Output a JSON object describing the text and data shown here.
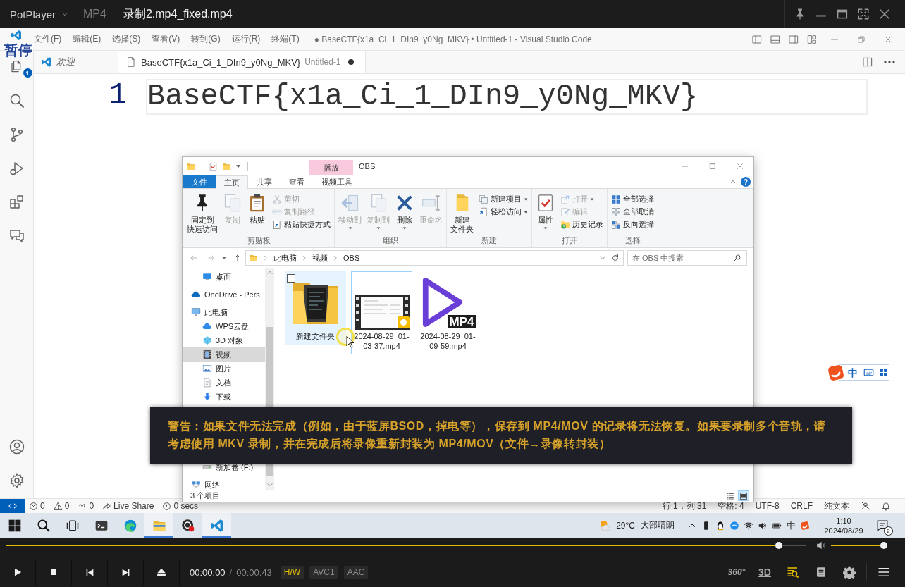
{
  "player": {
    "menu_label": "PotPlayer",
    "format": "MP4",
    "file_name": "录制2.mp4_fixed.mp4"
  },
  "osd": "暂停",
  "vscode": {
    "menu": [
      "文件(F)",
      "编辑(E)",
      "选择(S)",
      "查看(V)",
      "转到(G)",
      "运行(R)",
      "终端(T)"
    ],
    "title": "● BaseCTF{x1a_Ci_1_DIn9_y0Ng_MKV} • Untitled-1 - Visual Studio Code",
    "explorer_badge": "1",
    "tabs": [
      {
        "kind": "welcome",
        "label": "欢迎",
        "preview": true,
        "selected": false,
        "dirty": false
      },
      {
        "kind": "file",
        "label": "BaseCTF{x1a_Ci_1_DIn9_y0Ng_MKV}",
        "description": "Untitled-1",
        "preview": false,
        "selected": true,
        "dirty": true
      }
    ],
    "lines": [
      {
        "number": "1",
        "text": "BaseCTF{x1a_Ci_1_DIn9_y0Ng_MKV}",
        "current": true
      }
    ],
    "status_left": [
      {
        "kind": "errors",
        "text": "0"
      },
      {
        "kind": "warnings",
        "text": "0"
      },
      {
        "kind": "ports",
        "text": "0"
      },
      {
        "kind": "live-share",
        "text": "Live Share"
      },
      {
        "kind": "timer",
        "text": "0 secs"
      }
    ],
    "status_right": [
      "行 1，列 31",
      "空格: 4",
      "UTF-8",
      "CRLF",
      "纯文本"
    ]
  },
  "explorer": {
    "title": "OBS",
    "context_tab": "播放",
    "help": "?",
    "ribbon_tabs": [
      {
        "kind": "file",
        "label": "文件",
        "selected": false
      },
      {
        "kind": "tab",
        "label": "主页",
        "selected": true
      },
      {
        "kind": "tab",
        "label": "共享",
        "selected": false
      },
      {
        "kind": "tab",
        "label": "查看",
        "selected": false
      },
      {
        "kind": "tab",
        "label": "视频工具",
        "selected": false
      }
    ],
    "ribbon_groups": [
      {
        "label": "剪贴板",
        "buttons": [
          {
            "kind": "pin",
            "label_lines": [
              "固定到",
              "快速访问"
            ],
            "disabled": false,
            "menu": false
          },
          {
            "kind": "copy",
            "label_lines": [
              "复制"
            ],
            "disabled": true,
            "menu": false
          },
          {
            "kind": "paste",
            "label_lines": [
              "粘贴"
            ],
            "disabled": false,
            "menu": false
          }
        ],
        "small_buttons": [
          {
            "kind": "cut",
            "label": "剪切",
            "disabled": true,
            "menu": false
          },
          {
            "kind": "copy-path",
            "label": "复制路径",
            "disabled": true,
            "menu": false
          },
          {
            "kind": "shortcut",
            "label": "粘贴快捷方式",
            "disabled": false,
            "menu": false
          }
        ]
      },
      {
        "label": "组织",
        "buttons": [
          {
            "kind": "move",
            "label_lines": [
              "移动到"
            ],
            "disabled": true,
            "menu": true
          },
          {
            "kind": "copy-to",
            "label_lines": [
              "复制到"
            ],
            "disabled": true,
            "menu": true
          },
          {
            "kind": "delete",
            "label_lines": [
              "删除"
            ],
            "disabled": false,
            "menu": true
          },
          {
            "kind": "rename",
            "label_lines": [
              "重命名"
            ],
            "disabled": true,
            "menu": false
          }
        ]
      },
      {
        "label": "新建",
        "buttons": [
          {
            "kind": "new-folder",
            "label_lines": [
              "新建",
              "文件夹"
            ],
            "disabled": false,
            "menu": false
          }
        ],
        "small_buttons": [
          {
            "kind": "new-item",
            "label": "新建项目",
            "disabled": false,
            "menu": true
          },
          {
            "kind": "easy-access",
            "label": "轻松访问",
            "disabled": false,
            "menu": true
          }
        ]
      },
      {
        "label": "打开",
        "buttons": [
          {
            "kind": "properties",
            "label_lines": [
              "属性"
            ],
            "disabled": false,
            "menu": true
          }
        ],
        "small_buttons": [
          {
            "kind": "open",
            "label": "打开",
            "disabled": true,
            "menu": true
          },
          {
            "kind": "edit",
            "label": "编辑",
            "disabled": true,
            "menu": false
          },
          {
            "kind": "history",
            "label": "历史记录",
            "disabled": false,
            "menu": false
          }
        ]
      },
      {
        "label": "选择",
        "small_buttons": [
          {
            "kind": "select-all",
            "label": "全部选择",
            "disabled": false,
            "menu": false
          },
          {
            "kind": "select-none",
            "label": "全部取消",
            "disabled": false,
            "menu": false
          },
          {
            "kind": "invert",
            "label": "反向选择",
            "disabled": false,
            "menu": false
          }
        ]
      }
    ],
    "address": {
      "path": [
        "此电脑",
        "视频",
        "OBS"
      ],
      "search_placeholder": "在 OBS 中搜索"
    },
    "nav": [
      {
        "children": [
          {
            "kind": "desktop",
            "label": "桌面",
            "selected": false
          }
        ]
      },
      {
        "kind": "onedrive",
        "label": "OneDrive - Pers",
        "selected": false
      },
      {
        "kind": "pc",
        "label": "此电脑",
        "selected": false,
        "children": [
          {
            "kind": "cloud",
            "label": "WPS云盘",
            "selected": false
          },
          {
            "kind": "objects",
            "label": "3D 对象",
            "selected": false
          },
          {
            "kind": "videos",
            "label": "视频",
            "selected": true
          },
          {
            "kind": "pictures",
            "label": "图片",
            "selected": false
          },
          {
            "kind": "documents",
            "label": "文档",
            "selected": false
          },
          {
            "kind": "downloads",
            "label": "下载",
            "selected": false
          },
          {
            "kind": "drive",
            "label": "新加卷 (F:)",
            "selected": false
          }
        ]
      },
      {
        "kind": "network",
        "label": "网络",
        "selected": false
      }
    ],
    "files": [
      {
        "kind": "folder",
        "name": "新建文件夹",
        "selected": false,
        "hovered": true
      },
      {
        "kind": "video",
        "name": "2024-08-29_01-03-37.mp4",
        "selected": true,
        "hovered": false
      },
      {
        "kind": "mp4",
        "name": "2024-08-29_01-09-59.mp4",
        "icon_label": "MP4",
        "selected": false,
        "hovered": false
      }
    ],
    "item_count": "3 个项目",
    "views": [
      {
        "kind": "details",
        "selected": false
      },
      {
        "kind": "large-icons",
        "selected": true
      }
    ]
  },
  "ime": "中",
  "obs_warning": "警告：如果文件无法完成（例如，由于蓝屏BSOD，掉电等），保存到 MP4/MOV 的记录将无法恢复。如果要录制多个音轨，请考虑使用 MKV 录制，并在完成后将录像重新封装为 MP4/MOV（文件→录像转封装）",
  "taskbar": {
    "apps": [
      {
        "kind": "start",
        "active": false
      },
      {
        "kind": "search",
        "active": false
      },
      {
        "kind": "task-view",
        "active": false
      },
      {
        "kind": "terminal",
        "active": false
      },
      {
        "kind": "edge",
        "active": false
      },
      {
        "kind": "explorer",
        "active": true
      },
      {
        "kind": "obs",
        "active": false
      },
      {
        "kind": "vscode",
        "active": true
      }
    ],
    "weather": {
      "temp": "29°C",
      "condition": "大部晴朗"
    },
    "input_indicator": "中",
    "time": "1:10",
    "date": "2024/08/29",
    "notifications": "2"
  },
  "controls": {
    "seek": {
      "level": 0.97
    },
    "volume": {
      "level": 1
    },
    "current_time": "00:00:00",
    "separator": "/",
    "total_time": "00:00:43",
    "badges": [
      {
        "label": "H/W",
        "active": true
      },
      {
        "label": "AVC1",
        "active": false
      },
      {
        "label": "AAC",
        "active": false
      }
    ],
    "view_buttons": [
      "360°",
      "3D"
    ]
  }
}
